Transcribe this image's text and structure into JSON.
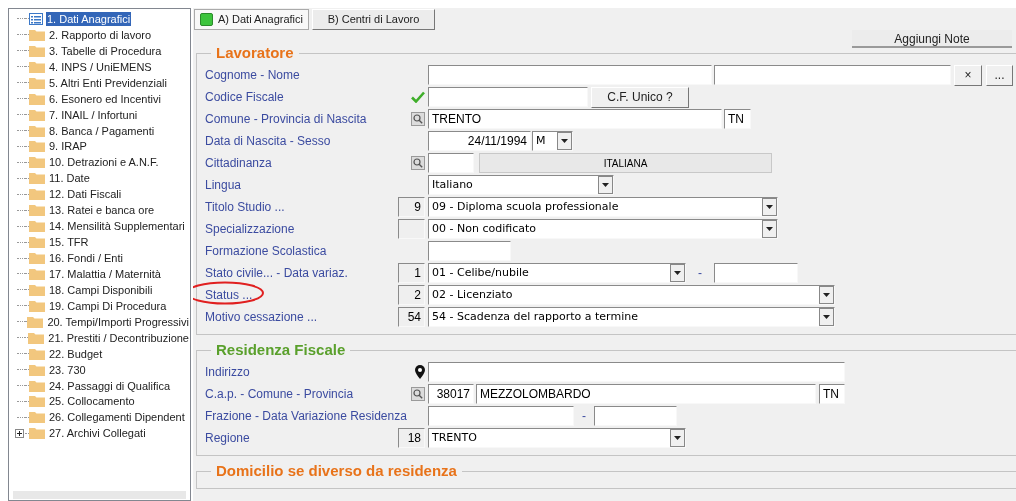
{
  "tree": {
    "items": [
      {
        "label": "1. Dati Anagrafici",
        "selected": true,
        "expandable": false
      },
      {
        "label": "2. Rapporto di lavoro",
        "selected": false,
        "expandable": false
      },
      {
        "label": "3. Tabelle di Procedura",
        "selected": false,
        "expandable": false
      },
      {
        "label": "4. INPS / UniEMENS",
        "selected": false,
        "expandable": false
      },
      {
        "label": "5. Altri Enti Previdenziali",
        "selected": false,
        "expandable": false
      },
      {
        "label": "6. Esonero ed Incentivi",
        "selected": false,
        "expandable": false
      },
      {
        "label": "7. INAIL / Infortuni",
        "selected": false,
        "expandable": false
      },
      {
        "label": "8. Banca / Pagamenti",
        "selected": false,
        "expandable": false
      },
      {
        "label": "9. IRAP",
        "selected": false,
        "expandable": false
      },
      {
        "label": "10. Detrazioni e A.N.F.",
        "selected": false,
        "expandable": false
      },
      {
        "label": "11. Date",
        "selected": false,
        "expandable": false
      },
      {
        "label": "12. Dati Fiscali",
        "selected": false,
        "expandable": false
      },
      {
        "label": "13. Ratei e banca ore",
        "selected": false,
        "expandable": false
      },
      {
        "label": "14. Mensilità Supplementari",
        "selected": false,
        "expandable": false
      },
      {
        "label": "15. TFR",
        "selected": false,
        "expandable": false
      },
      {
        "label": "16. Fondi / Enti",
        "selected": false,
        "expandable": false
      },
      {
        "label": "17. Malattia / Maternità",
        "selected": false,
        "expandable": false
      },
      {
        "label": "18. Campi Disponibili",
        "selected": false,
        "expandable": false
      },
      {
        "label": "19. Campi Di Procedura",
        "selected": false,
        "expandable": false
      },
      {
        "label": "20. Tempi/Importi Progressivi",
        "selected": false,
        "expandable": false
      },
      {
        "label": "21. Prestiti / Decontribuzione",
        "selected": false,
        "expandable": false
      },
      {
        "label": "22. Budget",
        "selected": false,
        "expandable": false
      },
      {
        "label": "23. 730",
        "selected": false,
        "expandable": false
      },
      {
        "label": "24. Passaggi di Qualifica",
        "selected": false,
        "expandable": false
      },
      {
        "label": "25. Collocamento",
        "selected": false,
        "expandable": false
      },
      {
        "label": "26. Collegamenti Dipendent",
        "selected": false,
        "expandable": false
      },
      {
        "label": "27. Archivi Collegati",
        "selected": false,
        "expandable": true
      }
    ]
  },
  "tabs": [
    {
      "label": "A) Dati Anagrafici",
      "selected": true
    },
    {
      "label": "B) Centri di Lavoro",
      "selected": false
    }
  ],
  "notes_button": "Aggiungi Note",
  "sections": [
    {
      "title": "Lavoratore",
      "color": "#e8731a",
      "rows": [
        {
          "label": "Cognome - Nome",
          "circled": false,
          "fields": [
            {
              "kind": "input"
            },
            {
              "kind": "input"
            },
            {
              "kind": "button",
              "value": "×"
            },
            {
              "kind": "button",
              "value": "..."
            }
          ]
        },
        {
          "label": "Codice Fiscale",
          "circled": false,
          "adornment": {
            "kind": "check"
          },
          "fields": [
            {
              "kind": "input"
            },
            {
              "kind": "button",
              "value": "C.F. Unico ?"
            }
          ]
        },
        {
          "label": "Comune - Provincia di Nascita",
          "circled": false,
          "adornment": {
            "kind": "search"
          },
          "fields": [
            {
              "kind": "input",
              "value": "TRENTO"
            },
            {
              "kind": "input",
              "value": "TN"
            }
          ]
        },
        {
          "label": "Data di Nascita - Sesso",
          "circled": false,
          "fields": [
            {
              "kind": "input",
              "value": "24/11/1994"
            },
            {
              "kind": "select",
              "value": "M"
            }
          ]
        },
        {
          "label": "Cittadinanza",
          "circled": false,
          "adornment": {
            "kind": "search"
          },
          "fields": [
            {
              "kind": "input"
            },
            {
              "kind": "readonly",
              "value": "ITALIANA"
            }
          ]
        },
        {
          "label": "Lingua",
          "circled": false,
          "fields": [
            {
              "kind": "select",
              "value": "Italiano"
            }
          ]
        },
        {
          "label": "Titolo Studio ...",
          "circled": false,
          "adornment": {
            "kind": "code",
            "value": "9"
          },
          "fields": [
            {
              "kind": "select",
              "value": "09 - Diploma scuola professionale"
            }
          ]
        },
        {
          "label": "Specializzazione",
          "circled": false,
          "adornment": {
            "kind": "code"
          },
          "fields": [
            {
              "kind": "select",
              "value": "00 - Non codificato"
            }
          ]
        },
        {
          "label": "Formazione Scolastica",
          "circled": false,
          "fields": [
            {
              "kind": "input"
            }
          ]
        },
        {
          "label": "Stato civile... - Data variaz.",
          "circled": false,
          "adornment": {
            "kind": "code",
            "value": "1"
          },
          "fields": [
            {
              "kind": "select",
              "value": "01 - Celibe/nubile"
            },
            {
              "kind": "dash",
              "value": "-"
            },
            {
              "kind": "input"
            }
          ]
        },
        {
          "label": "Status ...",
          "circled": true,
          "adornment": {
            "kind": "code",
            "value": "2"
          },
          "fields": [
            {
              "kind": "select",
              "value": "02 - Licenziato"
            }
          ]
        },
        {
          "label": "Motivo cessazione ...",
          "circled": false,
          "adornment": {
            "kind": "code",
            "value": "54"
          },
          "fields": [
            {
              "kind": "select",
              "value": "54 - Scadenza del rapporto a termine"
            }
          ]
        }
      ]
    },
    {
      "title": "Residenza Fiscale",
      "color": "#5aa02c",
      "rows": [
        {
          "label": "Indirizzo",
          "circled": false,
          "adornment": {
            "kind": "pin"
          },
          "fields": [
            {
              "kind": "input"
            }
          ]
        },
        {
          "label": "C.a.p. - Comune - Provincia",
          "circled": false,
          "adornment": {
            "kind": "search"
          },
          "fields": [
            {
              "kind": "input",
              "value": "38017"
            },
            {
              "kind": "input",
              "value": "MEZZOLOMBARDO"
            },
            {
              "kind": "input",
              "value": "TN"
            }
          ]
        },
        {
          "label": "Frazione - Data Variazione Residenza",
          "circled": false,
          "fields": [
            {
              "kind": "input"
            },
            {
              "kind": "dash",
              "value": "-"
            },
            {
              "kind": "input"
            }
          ]
        },
        {
          "label": "Regione",
          "circled": false,
          "adornment": {
            "kind": "code",
            "value": "18"
          },
          "fields": [
            {
              "kind": "select",
              "value": "TRENTO"
            }
          ]
        }
      ]
    },
    {
      "title": "Domicilio se diverso da residenza",
      "color": "#e8731a"
    }
  ]
}
